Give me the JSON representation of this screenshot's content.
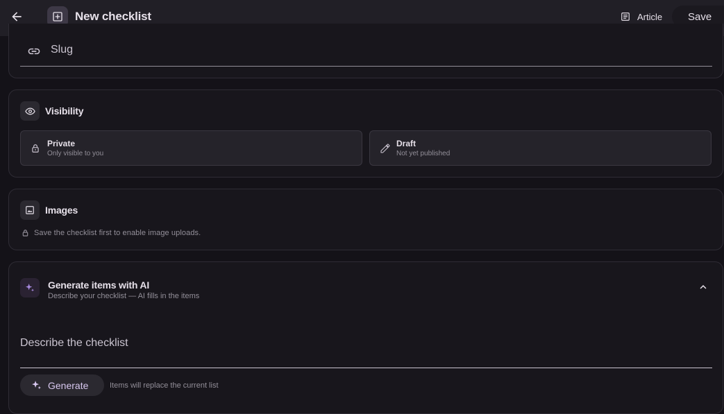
{
  "header": {
    "title": "New checklist",
    "article_label": "Article",
    "save_label": "Save"
  },
  "slug": {
    "label": "Slug"
  },
  "visibility": {
    "title": "Visibility",
    "options": [
      {
        "title": "Private",
        "subtitle": "Only visible to you",
        "icon": "lock-icon"
      },
      {
        "title": "Draft",
        "subtitle": "Not yet published",
        "icon": "pencil-icon"
      }
    ]
  },
  "images": {
    "title": "Images",
    "note": "Save the checklist first to enable image uploads."
  },
  "ai": {
    "title": "Generate items with AI",
    "subtitle": "Describe your checklist — AI fills in the items",
    "field_label": "Describe the checklist",
    "generate_label": "Generate",
    "generate_note": "Items will replace the current list"
  },
  "colors": {
    "background": "#141218",
    "topbar": "#211f26",
    "accent": "#a98be0"
  }
}
